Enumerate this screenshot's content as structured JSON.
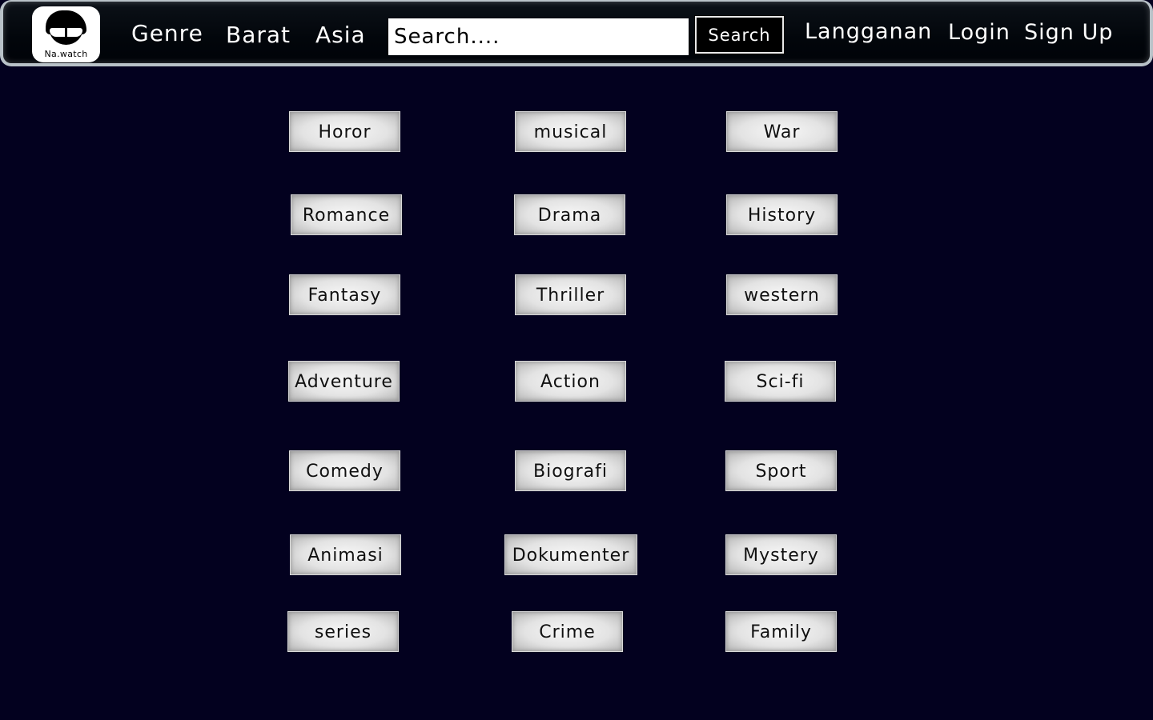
{
  "brand": {
    "name": "Na.watch"
  },
  "nav": {
    "genre": "Genre",
    "barat": "Barat",
    "asia": "Asia",
    "langganan": "Langganan",
    "login": "Login",
    "signup": "Sign Up"
  },
  "search": {
    "placeholder": "Search....",
    "button": "Search"
  },
  "genres": [
    "Horor",
    "musical",
    "War",
    "Romance",
    "Drama",
    "History",
    "Fantasy",
    "Thriller",
    "western",
    "Adventure",
    "Action",
    "Sci-fi",
    "Comedy",
    "Biografi",
    "Sport",
    "Animasi",
    "Dokumenter",
    "Mystery",
    "series",
    "Crime",
    "Family"
  ],
  "colors": {
    "page_background": "#03011f",
    "navbar_background": "#02060b",
    "navbar_border": "#b9c2c8",
    "button_face": "#e3e3e3"
  }
}
